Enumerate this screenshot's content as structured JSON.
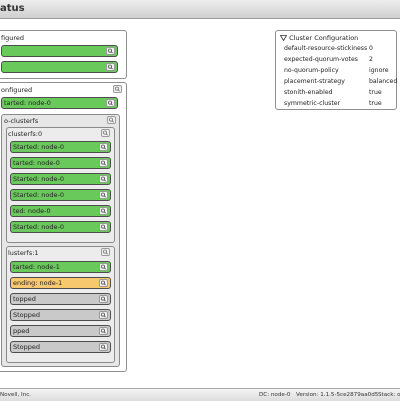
{
  "window": {
    "title": "atus"
  },
  "configured_panel": {
    "title": "figured",
    "resources": [
      {
        "label": "",
        "status": "green"
      },
      {
        "label": "",
        "status": "green"
      }
    ]
  },
  "main_panel": {
    "title": "onfigured",
    "resource": {
      "label": "tarted: node-0",
      "status": "green"
    },
    "group": {
      "title": "o-clusterfs",
      "clone0": {
        "title": "clusterfs:0",
        "resources": [
          {
            "label": "Started: node-0",
            "status": "green"
          },
          {
            "label": "tarted: node-0",
            "status": "green"
          },
          {
            "label": "Started: node-0",
            "status": "green"
          },
          {
            "label": "Started: node-0",
            "status": "green"
          },
          {
            "label": "ted: node-0",
            "status": "green"
          },
          {
            "label": "Started: node-0",
            "status": "green"
          }
        ]
      },
      "clone1": {
        "title": "lusterfs:1",
        "resources": [
          {
            "label": "tarted: node-1",
            "status": "green"
          },
          {
            "label": "ending: node-1",
            "status": "orange"
          },
          {
            "label": "topped",
            "status": "gray"
          },
          {
            "label": "Stopped",
            "status": "gray"
          },
          {
            "label": "pped",
            "status": "gray"
          },
          {
            "label": "Stopped",
            "status": "gray"
          }
        ]
      }
    }
  },
  "cluster_config": {
    "title": "Cluster Configuration",
    "rows": [
      {
        "key": "default-resource-stickiness",
        "value": "0"
      },
      {
        "key": "expected-quorum-votes",
        "value": "2"
      },
      {
        "key": "no-quorum-policy",
        "value": "ignore"
      },
      {
        "key": "placement-strategy",
        "value": "balanced"
      },
      {
        "key": "stonith-enabled",
        "value": "true"
      },
      {
        "key": "symmetric-cluster",
        "value": "true"
      }
    ]
  },
  "statusbar": {
    "copyright": "Novell, Inc.",
    "dc": "DC: node-0",
    "version": "Version: 1.1.5-5ce2879aa0d5",
    "stack": "Stack: op"
  },
  "colors": {
    "running": "#6ac95b",
    "pending": "#f7c86e",
    "stopped": "#c9c9c9"
  },
  "icons": {
    "zoom": "magnifier-icon",
    "collapse": "triangle-down-icon"
  }
}
